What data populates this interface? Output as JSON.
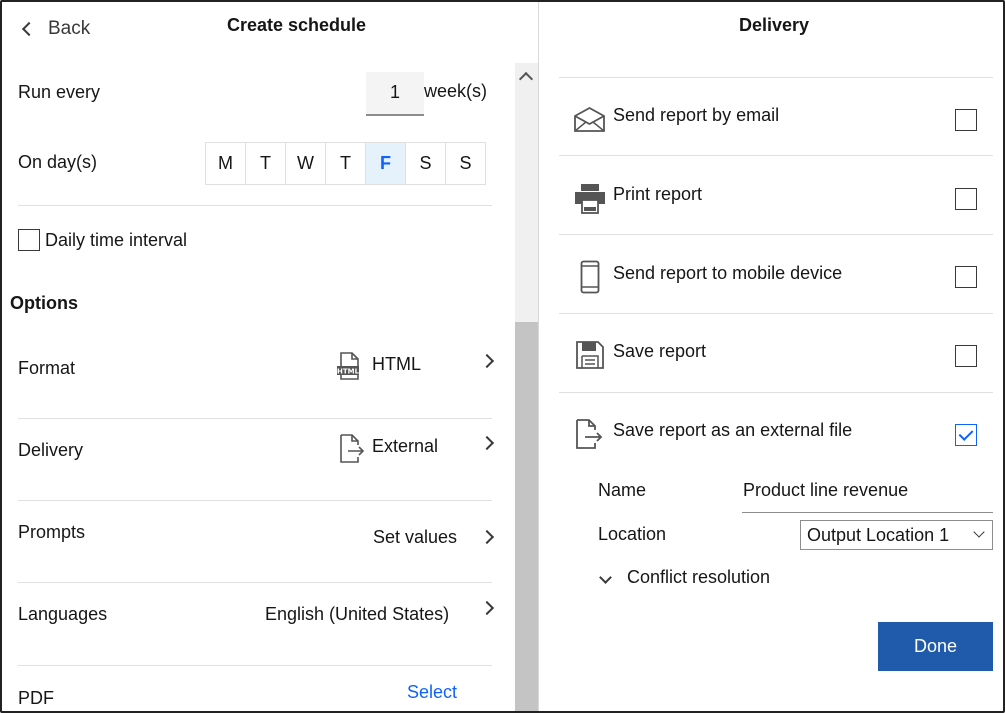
{
  "left": {
    "back_label": "Back",
    "title": "Create schedule",
    "run_every": {
      "label": "Run every",
      "value": "1",
      "unit": "week(s)"
    },
    "on_days": {
      "label": "On day(s)",
      "days": [
        "M",
        "T",
        "W",
        "T",
        "F",
        "S",
        "S"
      ],
      "selected_index": 4
    },
    "daily_interval": {
      "label": "Daily time interval",
      "checked": false
    },
    "options_title": "Options",
    "options": {
      "format": {
        "label": "Format",
        "value": "HTML",
        "icon": "html-file-icon"
      },
      "delivery": {
        "label": "Delivery",
        "value": "External",
        "icon": "external-file-icon"
      },
      "prompts": {
        "label": "Prompts",
        "value": "Set values"
      },
      "languages": {
        "label": "Languages",
        "value": "English (United States)"
      },
      "pdf": {
        "label": "PDF",
        "value": "Select"
      }
    }
  },
  "right": {
    "title": "Delivery",
    "items": [
      {
        "label": "Send report by email",
        "icon": "email-icon",
        "checked": false
      },
      {
        "label": "Print report",
        "icon": "printer-icon",
        "checked": false
      },
      {
        "label": "Send report to mobile device",
        "icon": "mobile-icon",
        "checked": false
      },
      {
        "label": "Save report",
        "icon": "save-icon",
        "checked": false
      },
      {
        "label": "Save report as an external file",
        "icon": "external-file-icon",
        "checked": true
      }
    ],
    "name": {
      "label": "Name",
      "value": "Product line revenue"
    },
    "location": {
      "label": "Location",
      "value": "Output Location 1"
    },
    "conflict_label": "Conflict resolution",
    "done_label": "Done"
  },
  "colors": {
    "accent": "#0f62fe",
    "done_button": "#1f5baa",
    "selected_day": "#e5f1fb"
  }
}
